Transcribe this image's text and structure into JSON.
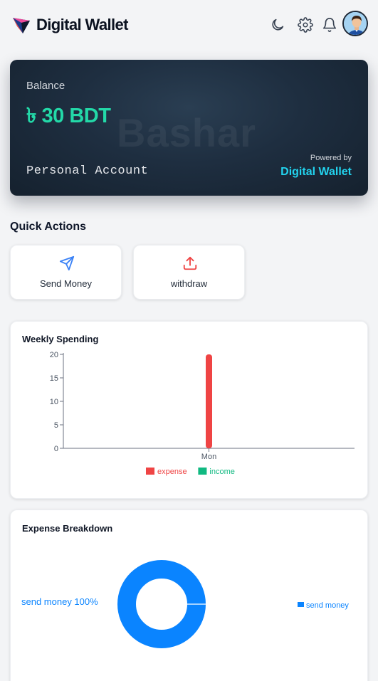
{
  "header": {
    "app_title": "Digital Wallet"
  },
  "balance_card": {
    "label": "Balance",
    "amount": "৳ 30 BDT",
    "watermark": "Bashar",
    "account_type": "Personal Account",
    "powered_by": "Powered by",
    "powered_brand": "Digital Wallet"
  },
  "quick_actions": {
    "title": "Quick Actions",
    "items": [
      {
        "label": "Send Money",
        "icon": "send-icon",
        "color": "#3b82f6"
      },
      {
        "label": "withdraw",
        "icon": "upload-icon",
        "color": "#ef4444"
      }
    ]
  },
  "weekly_spending": {
    "title": "Weekly Spending"
  },
  "expense_breakdown": {
    "title": "Expense Breakdown"
  },
  "colors": {
    "expense": "#ef4444",
    "income": "#10b981",
    "send_money": "#0a84ff",
    "accent": "#23d9a8"
  },
  "chart_data": [
    {
      "type": "bar",
      "title": "Weekly Spending",
      "categories": [
        "Mon"
      ],
      "series": [
        {
          "name": "expense",
          "values": [
            20
          ],
          "color": "#ef4444"
        },
        {
          "name": "income",
          "values": [
            0
          ],
          "color": "#10b981"
        }
      ],
      "yticks": [
        0,
        5,
        10,
        15,
        20
      ],
      "ylim": [
        0,
        20
      ],
      "legend": "bottom"
    },
    {
      "type": "pie",
      "title": "Expense Breakdown",
      "slices": [
        {
          "name": "send money",
          "value": 100,
          "label": "send money 100%",
          "color": "#0a84ff"
        }
      ],
      "legend": "right"
    }
  ]
}
